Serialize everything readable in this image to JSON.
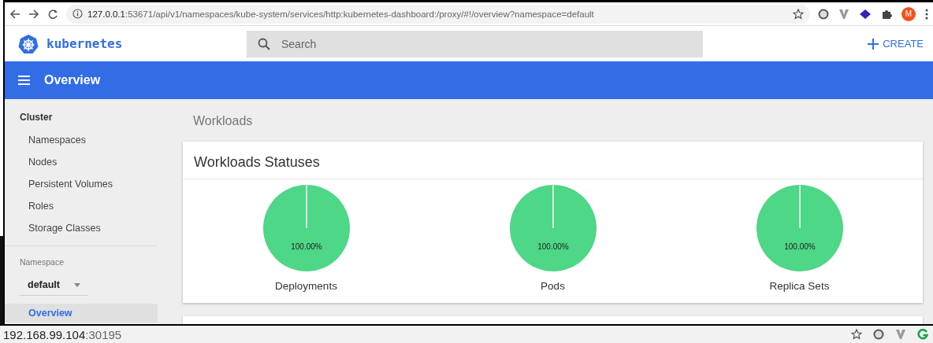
{
  "browser": {
    "url_host": "127.0.0.1",
    "url_rest": ":53671/api/v1/namespaces/kube-system/services/http:kubernetes-dashboard:/proxy/#!/overview?namespace=default",
    "avatar": "M"
  },
  "header": {
    "logo": "kubernetes",
    "search": {
      "placeholder": "Search"
    },
    "create": "CREATE"
  },
  "toolbar": {
    "title": "Overview"
  },
  "sidebar": {
    "section": "Cluster",
    "cluster_items": [
      {
        "label": "Namespaces",
        "selected": false
      },
      {
        "label": "Nodes",
        "selected": false
      },
      {
        "label": "Persistent Volumes",
        "selected": false
      },
      {
        "label": "Roles",
        "selected": false
      },
      {
        "label": "Storage Classes",
        "selected": false
      }
    ],
    "namespace_label": "Namespace",
    "namespace_value": "default",
    "items": [
      {
        "label": "Overview",
        "selected": true
      }
    ]
  },
  "main": {
    "section_title": "Workloads",
    "card_title": "Workloads Statuses",
    "charts": [
      {
        "chart_data": {
          "type": "pie",
          "title": "Deployments",
          "series": [
            {
              "color": "#4dd786",
              "values": [
                100
              ]
            }
          ],
          "value_labels": [
            "100.00%"
          ]
        }
      },
      {
        "chart_data": {
          "type": "pie",
          "title": "Pods",
          "series": [
            {
              "color": "#4dd786",
              "values": [
                100
              ]
            }
          ],
          "value_labels": [
            "100.00%"
          ]
        }
      },
      {
        "chart_data": {
          "type": "pie",
          "title": "Replica Sets",
          "series": [
            {
              "color": "#4dd786",
              "values": [
                100
              ]
            }
          ],
          "value_labels": [
            "100.00%"
          ]
        }
      }
    ]
  },
  "status_bar": {
    "host": "192.168.99.104",
    "port": ":30195"
  }
}
